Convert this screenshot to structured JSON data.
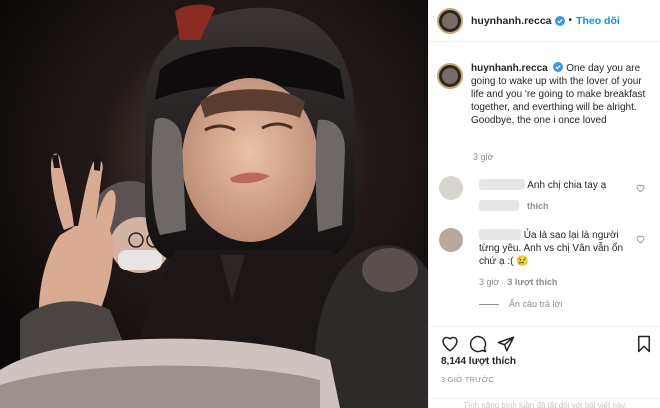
{
  "header": {
    "username": "huynhanh.recca",
    "separator": "•",
    "follow_label": "Theo dõi"
  },
  "caption": {
    "username": "huynhanh.recca",
    "text": "One day you are going to wake up with the lover of your life and you 're going to make breakfast together, and everthing will be alright. Goodbye, the one i once loved",
    "time": "3 giờ"
  },
  "comments": [
    {
      "text": "Anh chị chia tay ạ",
      "time": "",
      "like_label": "thích"
    },
    {
      "text": "Ủa là sao lại là người từng yêu. Anh vs chị Vân vẫn ổn chứ ạ :( 😢",
      "time": "3 giờ",
      "replies_label": "3 lượt thích",
      "hide_replies_label": "Ẩn câu trả lời"
    }
  ],
  "likes": "8,144 lượt thích",
  "post_time": "3 GIỜ TRƯỚC",
  "comments_disabled_note": "Tính năng bình luận đã tắt đối với bài viết này.",
  "colors": {
    "link_blue": "#0095f6",
    "verified_blue": "#3897f0",
    "muted": "#8e8e8e",
    "text": "#262626"
  },
  "icons": [
    "verified-badge-icon",
    "heart-icon",
    "comment-icon",
    "share-icon",
    "bookmark-icon"
  ]
}
